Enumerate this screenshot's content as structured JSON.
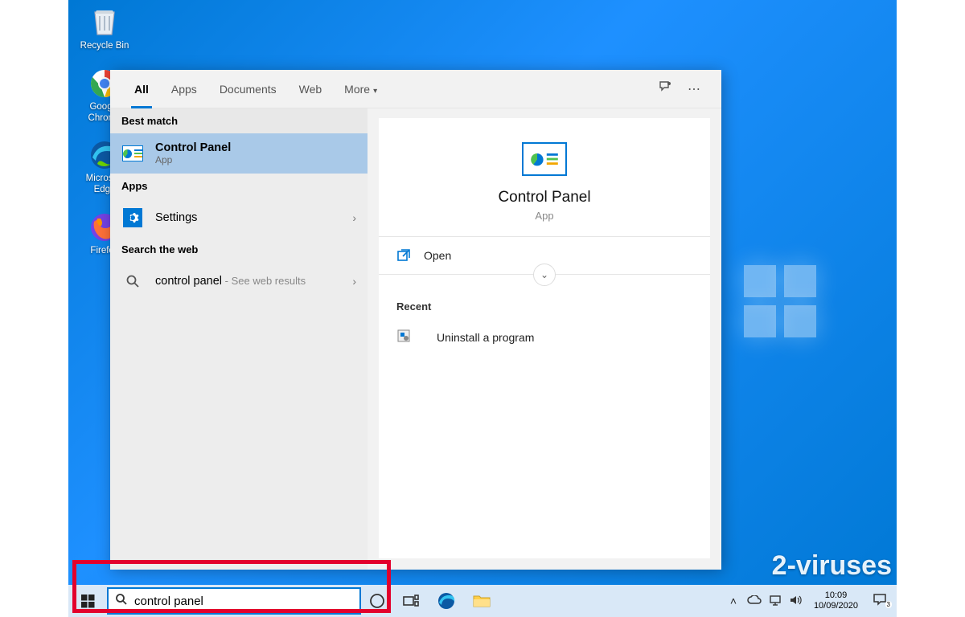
{
  "desktop_icons": {
    "recycle_bin": "Recycle Bin",
    "chrome": "Google Chrome",
    "edge": "Microsoft Edge",
    "firefox": "Firefox"
  },
  "search": {
    "tabs": {
      "all": "All",
      "apps": "Apps",
      "documents": "Documents",
      "web": "Web",
      "more": "More"
    },
    "sections": {
      "best_match": "Best match",
      "apps": "Apps",
      "web": "Search the web"
    },
    "best_match": {
      "title": "Control Panel",
      "subtitle": "App"
    },
    "apps_result": {
      "title": "Settings"
    },
    "web_result": {
      "query": "control panel",
      "suffix": " - See web results"
    },
    "detail": {
      "title": "Control Panel",
      "subtitle": "App",
      "open": "Open",
      "recent_header": "Recent",
      "recent_item": "Uninstall a program"
    },
    "input_value": "control panel"
  },
  "taskbar": {
    "time": "10:09",
    "date": "10/09/2020",
    "notif_count": "3"
  },
  "watermark": "2-viruses"
}
